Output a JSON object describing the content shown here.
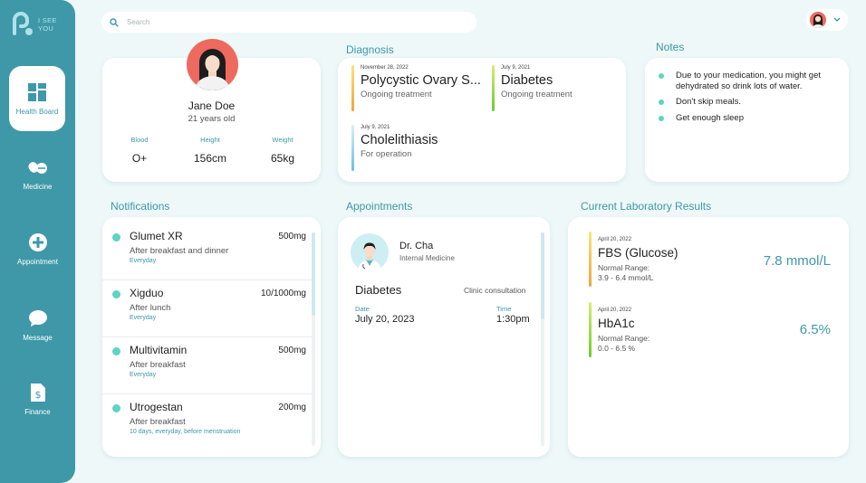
{
  "app": {
    "name_line1": "I SEE",
    "name_line2": "YOU"
  },
  "sidebar": {
    "items": [
      {
        "label": "Health Board",
        "icon": "dashboard-icon",
        "active": true
      },
      {
        "label": "Medicine",
        "icon": "pills-icon"
      },
      {
        "label": "Appointment",
        "icon": "plus-circle-icon"
      },
      {
        "label": "Message",
        "icon": "chat-bubble-icon"
      },
      {
        "label": "Finance",
        "icon": "document-dollar-icon"
      }
    ]
  },
  "search": {
    "placeholder": "Search"
  },
  "profile": {
    "name": "Jane Doe",
    "age": "21 years old",
    "stats": [
      {
        "label": "Blood",
        "value": "O+"
      },
      {
        "label": "Height",
        "value": "156cm"
      },
      {
        "label": "Weight",
        "value": "65kg"
      }
    ]
  },
  "diagnosis": {
    "title": "Diagnosis",
    "items": [
      {
        "date": "November 28, 2022",
        "title": "Polycystic Ovary S...",
        "status": "Ongoing treatment"
      },
      {
        "date": "July 9, 2021",
        "title": "Diabetes",
        "status": "Ongoing treatment"
      },
      {
        "date": "July 9, 2021",
        "title": "Cholelithiasis",
        "status": "For operation"
      }
    ]
  },
  "notes": {
    "title": "Notes",
    "items": [
      "Due to your medication, you might get dehydrated so drink lots of water.",
      "Don't skip meals.",
      "Get enough sleep"
    ]
  },
  "notifications": {
    "title": "Notifications",
    "items": [
      {
        "name": "Glumet XR",
        "dose": "500mg",
        "when": "After breakfast and dinner",
        "frequency": "Everyday"
      },
      {
        "name": "Xigduo",
        "dose": "10/1000mg",
        "when": "After lunch",
        "frequency": "Everyday"
      },
      {
        "name": "Multivitamin",
        "dose": "500mg",
        "when": "After breakfast",
        "frequency": "Everyday"
      },
      {
        "name": "Utrogestan",
        "dose": "200mg",
        "when": "After breakfast",
        "frequency": "10 days, everyday, before menstruation"
      }
    ]
  },
  "appointments": {
    "title": "Appointments",
    "doctor_name": "Dr. Cha",
    "specialty": "Internal Medicine",
    "condition": "Diabetes",
    "type": "Clinic consultation",
    "date_label": "Date",
    "date": "July 20, 2023",
    "time_label": "Time",
    "time": "1:30pm"
  },
  "lab": {
    "title": "Current Laboratory Results",
    "items": [
      {
        "date": "April 20, 2022",
        "test": "FBS (Glucose)",
        "range_label": "Normal Range:",
        "range": "3.9 - 6.4 mmol/L",
        "value": "7.8 mmol/L"
      },
      {
        "date": "April 20, 2022",
        "test": "HbA1c",
        "range_label": "Normal Range:",
        "range": "0.0 - 6.5 %",
        "value": "6.5%"
      }
    ]
  },
  "colors": {
    "accent": "#3e98a8",
    "sidebar": "#3e98a8",
    "background": "#eef8f9",
    "dot": "#5ed4c2"
  }
}
